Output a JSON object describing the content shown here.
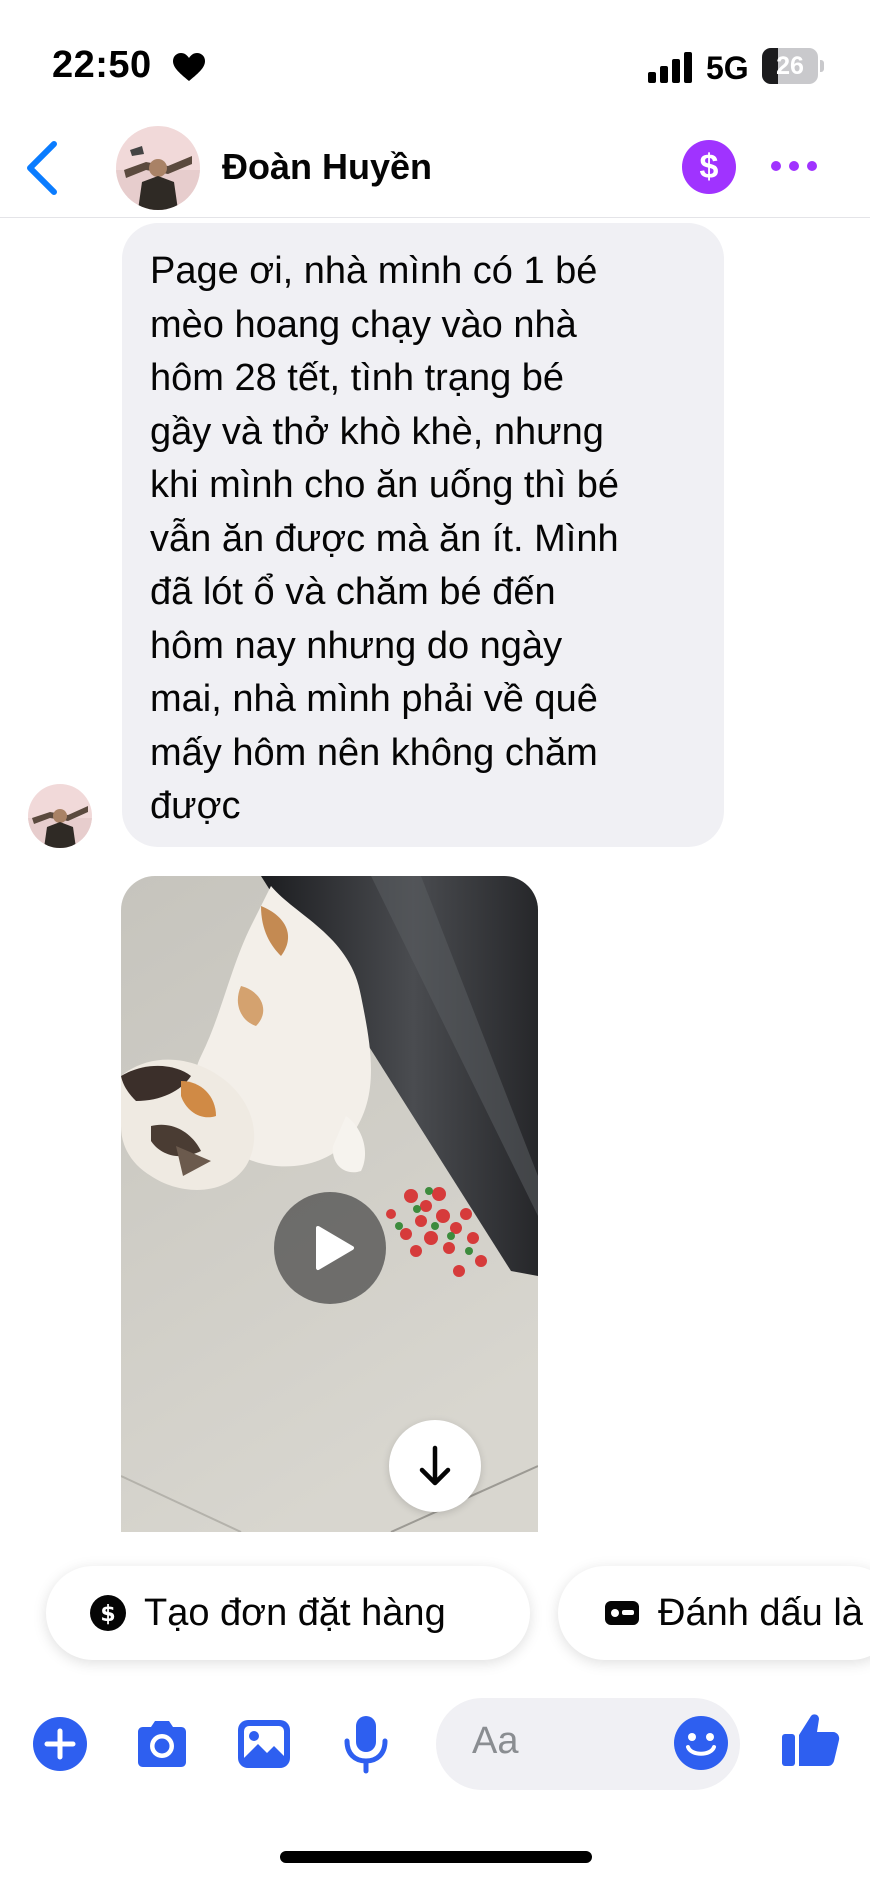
{
  "status_bar": {
    "time": "22:50",
    "network": "5G",
    "battery": "26"
  },
  "header": {
    "contact_name": "Đoàn Huyền",
    "payment_symbol": "$"
  },
  "messages": [
    {
      "text": "Page ơi, nhà mình có 1 bé\nmèo hoang chạy vào nhà\nhôm 28 tết, tình trạng bé\ngầy và thở khò khè,  nhưng\nkhi mình cho ăn uống thì bé\nvẫn ăn được mà ăn ít. Mình\nđã lót ổ và chăm bé đến\nhôm nay nhưng do ngày\nmai, nhà mình phải về quê\nmấy hôm nên không chăm\nđược"
    }
  ],
  "quick_replies": [
    {
      "label": "Tạo đơn đặt hàng",
      "icon": "dollar-circle-icon"
    },
    {
      "label": "Đánh dấu là",
      "icon": "tag-card-icon"
    }
  ],
  "composer": {
    "placeholder": "Aa"
  },
  "colors": {
    "accent": "#0a7cff",
    "composer_icons": "#2e5ff0",
    "payment": "#a033ff",
    "bubble": "#f0f0f4"
  }
}
